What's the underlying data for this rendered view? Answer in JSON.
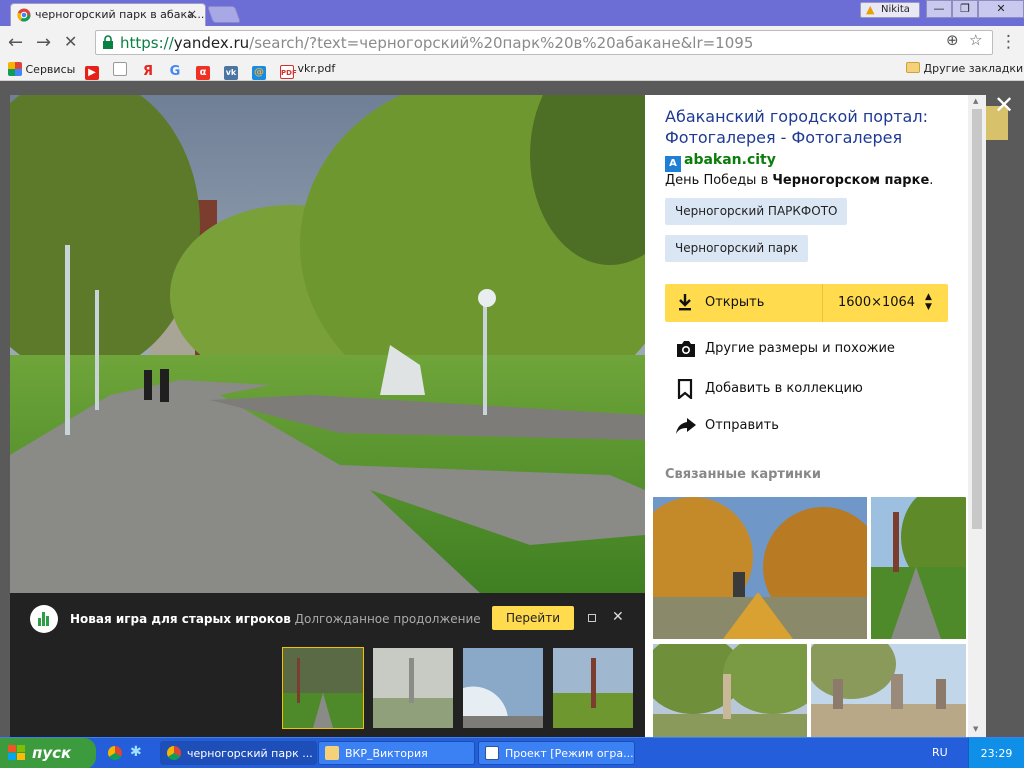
{
  "browser": {
    "tab_title": "черногорский парк в абака...",
    "tab_close": "×",
    "profile_name": "Nikita",
    "window_buttons": {
      "minimize": "—",
      "maximize": "❐",
      "close": "✕"
    },
    "url_scheme": "https://",
    "url_host": "yandex.ru",
    "url_path": "/search/?text=черногорский%20парк%20в%20абакане&lr=1095",
    "bookmarks": [
      {
        "label": "Сервисы",
        "icon": "apps-icon"
      },
      {
        "label": "",
        "icon": "youtube-icon"
      },
      {
        "label": "",
        "icon": "page-icon"
      },
      {
        "label": "",
        "icon": "yandex-icon"
      },
      {
        "label": "",
        "icon": "google-icon"
      },
      {
        "label": "",
        "icon": "alfa-icon"
      },
      {
        "label": "",
        "icon": "vk-icon"
      },
      {
        "label": "",
        "icon": "mail-icon"
      },
      {
        "label": "vkr.pdf",
        "icon": "pdf-icon"
      }
    ],
    "other_bookmarks": "Другие закладки"
  },
  "ad": {
    "title": "Новая игра для старых игроков",
    "text": "Долгожданное продолжение э...",
    "button": "Перейти"
  },
  "panel": {
    "title": "Абаканский городской портал: Фотогалерея - Фотогалерея",
    "site": "abakan.city",
    "site_favicon": "A",
    "desc_prefix": "День Победы в ",
    "desc_bold": "Черногорском парке",
    "desc_suffix": ".",
    "tags": [
      "Черногорский ПАРКФОТО",
      "Черногорский парк"
    ],
    "open_label": "Открыть",
    "image_size": "1600×1064",
    "actions": [
      "Другие размеры и похожие",
      "Добавить в коллекцию",
      "Отправить"
    ],
    "related_heading": "Связанные картинки"
  },
  "colors": {
    "accent_yellow": "#ffdb4d",
    "link_blue": "#1f3a93",
    "site_green": "#0b7d0b"
  },
  "taskbar": {
    "start": "пуск",
    "tasks": [
      "черногорский парк ...",
      "ВКР_Виктория",
      "Проект [Режим огра..."
    ],
    "language": "RU",
    "time": "23:29"
  }
}
